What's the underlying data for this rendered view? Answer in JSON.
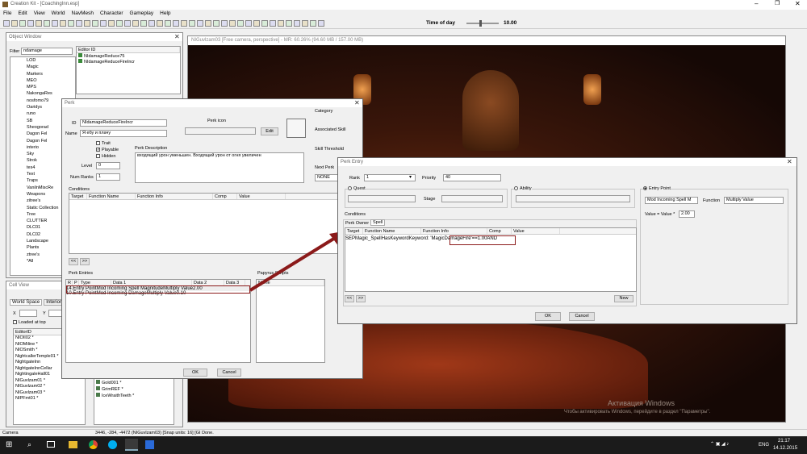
{
  "app": {
    "title": "Creation Kit - [CoachingInn.esp]",
    "time_label": "Time of day",
    "time_value": "10.00",
    "min_icon": "minimize-icon",
    "max_icon": "restore-icon",
    "close_icon": "close-icon"
  },
  "menu": [
    "File",
    "Edit",
    "View",
    "World",
    "NavMesh",
    "Character",
    "Gameplay",
    "Help"
  ],
  "viewport": {
    "title": "NIGuvlzam03 [Free camera, perspective] - MR: 60.26% (94.60 MB / 157.00 MB)",
    "watermark_title": "Активация Windows",
    "watermark_sub": "Чтобы активировать Windows, перейдите в раздел \"Параметры\"."
  },
  "object_window": {
    "title": "Object Window",
    "filter_label": "Filter",
    "filter_value": "ndamage",
    "editor_id_header": "Editor ID",
    "tree": [
      "LOD",
      "Magic",
      "Markers",
      "MEO",
      "MPS",
      "NakongaRes",
      "nosfomo79",
      "Oaridys",
      "runo",
      "SB",
      "Sheogorad",
      "Dagon Fel",
      "Dagon Fel",
      "interio",
      "Sky",
      "Strok",
      "tes4",
      "Text",
      "Traps",
      "VanilnMiscRe",
      "Weapons",
      "zitree's",
      "Static Collection",
      "Tree",
      "CLUTTER",
      "DLC01",
      "DLC02",
      "Landscape",
      "Plants",
      "ztree's",
      "*All"
    ],
    "items": [
      "NIdamageReduce75",
      "NIdamageReduceFireIncr"
    ]
  },
  "cell_view": {
    "title": "Cell View",
    "tab_world": "World Space",
    "tab_interiors": "Interiors",
    "x": "X",
    "y": "Y",
    "loaded": "Loaded at top",
    "editor_id_header": "EditorID",
    "cells": [
      "NIOII02 *",
      "NIOMiline *",
      "NIOSmith *",
      "NightcallerTemple01 *",
      "NightgateInn",
      "NightgateInnCellar",
      "NightingaleHall01",
      "NIGuvlzam01 *",
      "NIGuvlzam02 *",
      "NIGuvlzam03 *",
      "NIPFmt01 *"
    ],
    "refs": [
      "Gold001 *",
      "GrimREF *",
      "IceWraithTeeth *"
    ]
  },
  "perk": {
    "title": "Perk",
    "id_label": "ID",
    "id_value": "NIdamageReduceFireIncr",
    "name_label": "Name",
    "name_value": "Я ебу и плачу",
    "icon_label": "Perk icon",
    "edit_label": "Edit",
    "trait": "Trait",
    "playable": "Playable",
    "hidden": "Hidden",
    "level_label": "Level",
    "level_value": "0",
    "ranks_label": "Num Ranks",
    "ranks_value": "1",
    "desc_label": "Perk Description",
    "desc_value": "входящий урон уменьшен. Входящий урон от огня увеличен",
    "category_label": "Category",
    "assoc_label": "Associated Skill",
    "threshold_label": "Skill Threshold",
    "next_label": "Next Perk",
    "next_value": "NONE",
    "conditions_label": "Conditions",
    "cond_headers": [
      "Target",
      "Function Name",
      "Function Info",
      "Comp",
      "Value"
    ],
    "nav_prev": "<<",
    "nav_next": ">>",
    "entries_label": "Perk Entries",
    "entry_headers": [
      "R",
      "P",
      "Type",
      "Data 1",
      "Data 2",
      "Data 3"
    ],
    "entries": [
      {
        "r": "1",
        "p": "4.",
        "type": "Entry Point",
        "d1": "Mod Incoming Spell Magnitude",
        "d2": "Multiply Value",
        "d3": "2.00"
      },
      {
        "r": "1",
        "p": "0.",
        "type": "Entry Point",
        "d1": "Mod Incoming Damage",
        "d2": "Multiply Value",
        "d3": "0.10"
      }
    ],
    "papyrus_label": "Papyrus Scripts",
    "papyrus_header": "Name",
    "ok": "OK",
    "cancel": "Cancel"
  },
  "perk_entry": {
    "title": "Perk Entry",
    "rank_label": "Rank",
    "rank_value": "1",
    "priority_label": "Priority",
    "priority_value": "40",
    "quest_label": "Quest",
    "stage_label": "Stage",
    "ability_label": "Ability",
    "entry_point_label": "Entry Point",
    "entry_point_value": "Mod Incoming Spell M",
    "function_label": "Function",
    "function_value": "Multiply Value",
    "value_label": "Value = Value *",
    "value_value": "2.00",
    "conditions_label": "Conditions",
    "tab_owner": "Perk Owner",
    "tab_spell": "Spell",
    "cond_headers": [
      "Target",
      "Function Name",
      "Function Info",
      "Comp",
      "Value"
    ],
    "cond_rows": [
      {
        "target": "S",
        "func": "EPMagic_SpellHasKeyword",
        "info": "Keyword: 'MagicDamageFire'",
        "comp": "==",
        "value": "1.00",
        "extra": "AND"
      }
    ],
    "nav_prev": "<<",
    "nav_next": ">>",
    "new_label": "New",
    "ok": "OK",
    "cancel": "Cancel"
  },
  "status": {
    "left": "Camera",
    "coords": "3446, -284, -4472 (NIGuvlzam03) [Snap units: 16] [GI Done."
  },
  "taskbar": {
    "lang": "ENG",
    "time": "21:17",
    "date": "14.12.2015"
  },
  "colors": {
    "highlight": "#8b1a1a",
    "taskbar": "#1b1b1b"
  }
}
